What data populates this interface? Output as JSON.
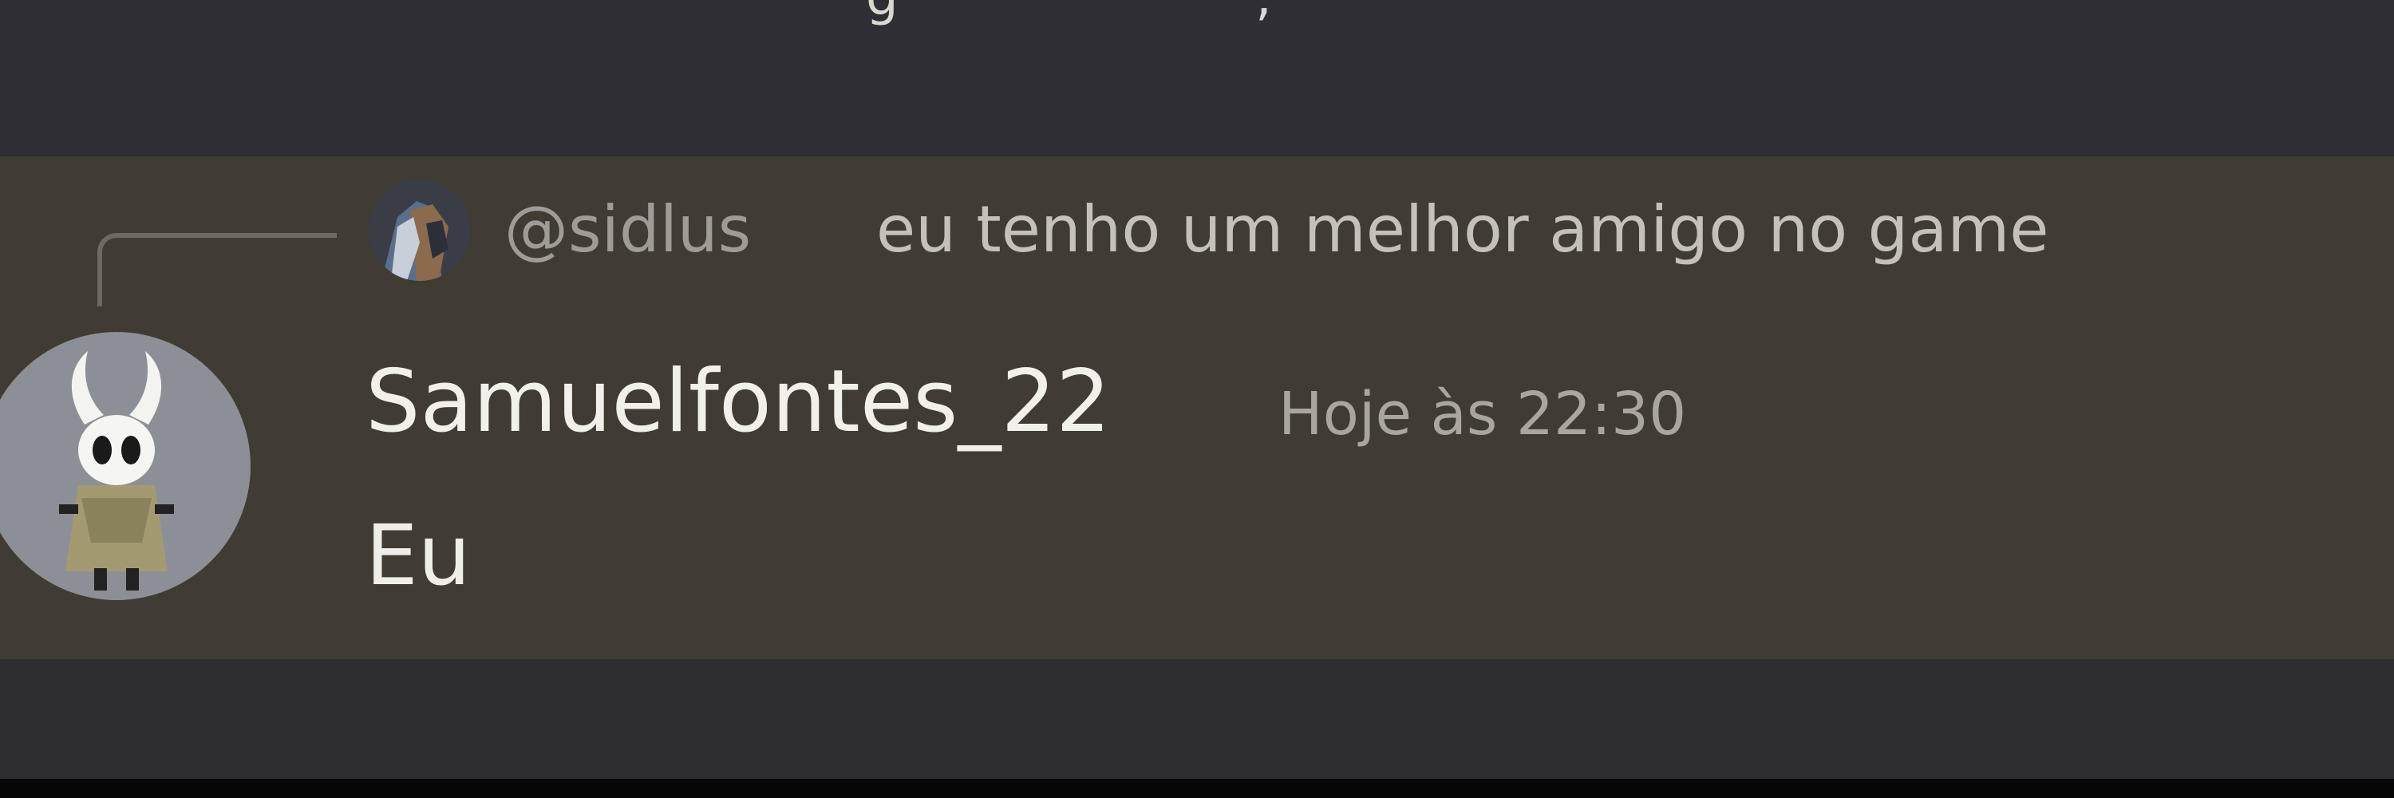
{
  "reply": {
    "mention": "@sidlus",
    "text": "eu tenho um melhor amigo no game",
    "avatar_icon": "reply-user-avatar"
  },
  "message": {
    "username": "Samuelfontes_22",
    "timestamp": "Hoje às 22:30",
    "content": "Eu",
    "avatar_icon": "hollow-knight-avatar"
  },
  "colors": {
    "background": "#2d2d32",
    "highlight_background": "#403b33",
    "username": "#f2f0ea",
    "mention": "#9e9c97"
  }
}
